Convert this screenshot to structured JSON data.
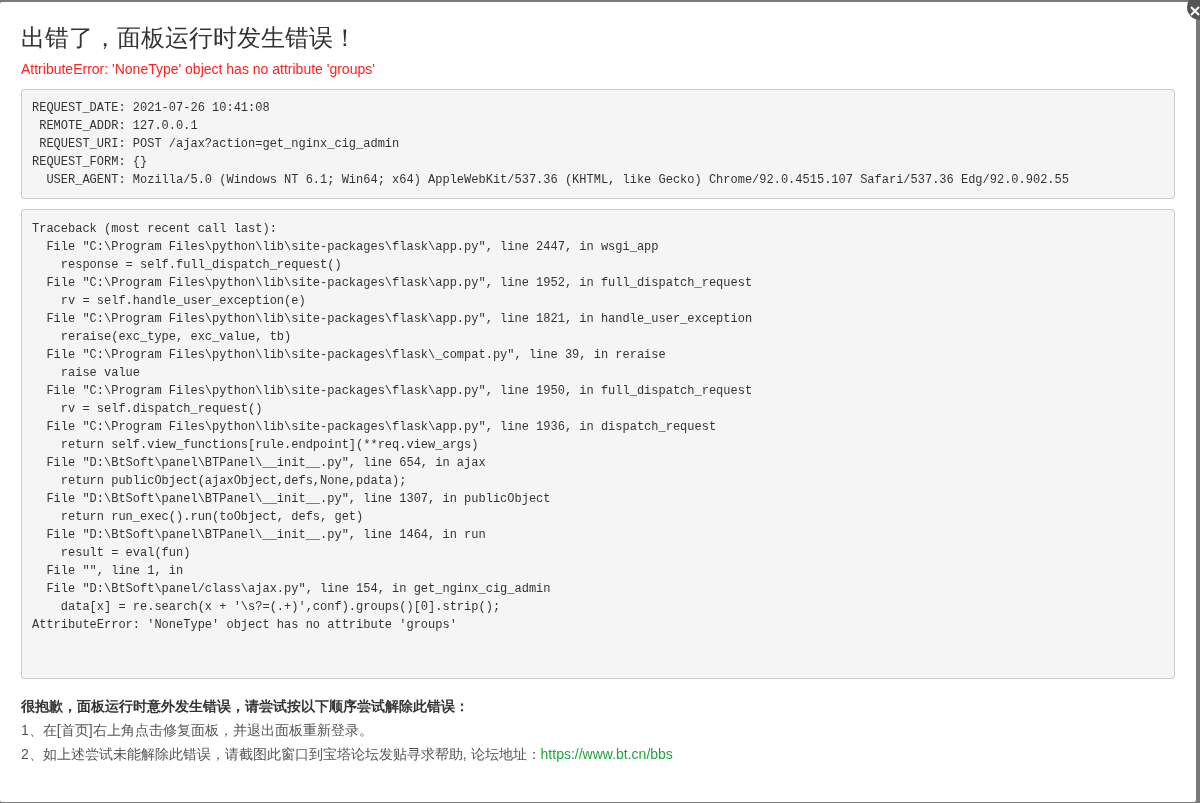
{
  "dialog": {
    "title": "出错了，面板运行时发生错误！",
    "error_message": "AttributeError: 'NoneType' object has no attribute 'groups'",
    "request_info": [
      "REQUEST_DATE: 2021-07-26 10:41:08",
      " REMOTE_ADDR: 127.0.0.1",
      " REQUEST_URI: POST /ajax?action=get_nginx_cig_admin",
      "REQUEST_FORM: {}",
      "  USER_AGENT: Mozilla/5.0 (Windows NT 6.1; Win64; x64) AppleWebKit/537.36 (KHTML, like Gecko) Chrome/92.0.4515.107 Safari/537.36 Edg/92.0.902.55"
    ],
    "traceback": [
      "Traceback (most recent call last):",
      "  File \"C:\\Program Files\\python\\lib\\site-packages\\flask\\app.py\", line 2447, in wsgi_app",
      "    response = self.full_dispatch_request()",
      "  File \"C:\\Program Files\\python\\lib\\site-packages\\flask\\app.py\", line 1952, in full_dispatch_request",
      "    rv = self.handle_user_exception(e)",
      "  File \"C:\\Program Files\\python\\lib\\site-packages\\flask\\app.py\", line 1821, in handle_user_exception",
      "    reraise(exc_type, exc_value, tb)",
      "  File \"C:\\Program Files\\python\\lib\\site-packages\\flask\\_compat.py\", line 39, in reraise",
      "    raise value",
      "  File \"C:\\Program Files\\python\\lib\\site-packages\\flask\\app.py\", line 1950, in full_dispatch_request",
      "    rv = self.dispatch_request()",
      "  File \"C:\\Program Files\\python\\lib\\site-packages\\flask\\app.py\", line 1936, in dispatch_request",
      "    return self.view_functions[rule.endpoint](**req.view_args)",
      "  File \"D:\\BtSoft\\panel\\BTPanel\\__init__.py\", line 654, in ajax",
      "    return publicObject(ajaxObject,defs,None,pdata);",
      "  File \"D:\\BtSoft\\panel\\BTPanel\\__init__.py\", line 1307, in publicObject",
      "    return run_exec().run(toObject, defs, get)",
      "  File \"D:\\BtSoft\\panel\\BTPanel\\__init__.py\", line 1464, in run",
      "    result = eval(fun)",
      "  File \"\", line 1, in",
      "  File \"D:\\BtSoft\\panel/class\\ajax.py\", line 154, in get_nginx_cig_admin",
      "    data[x] = re.search(x + '\\s?=(.+)',conf).groups()[0].strip();",
      "AttributeError: 'NoneType' object has no attribute 'groups'"
    ],
    "help": {
      "heading": "很抱歉，面板运行时意外发生错误，请尝试按以下顺序尝试解除此错误：",
      "steps": [
        {
          "text": "1、在[首页]右上角点击修复面板，并退出面板重新登录。"
        },
        {
          "text": "2、如上述尝试未能解除此错误，请截图此窗口到宝塔论坛发贴寻求帮助, 论坛地址：",
          "link": "https://www.bt.cn/bbs"
        }
      ]
    }
  }
}
